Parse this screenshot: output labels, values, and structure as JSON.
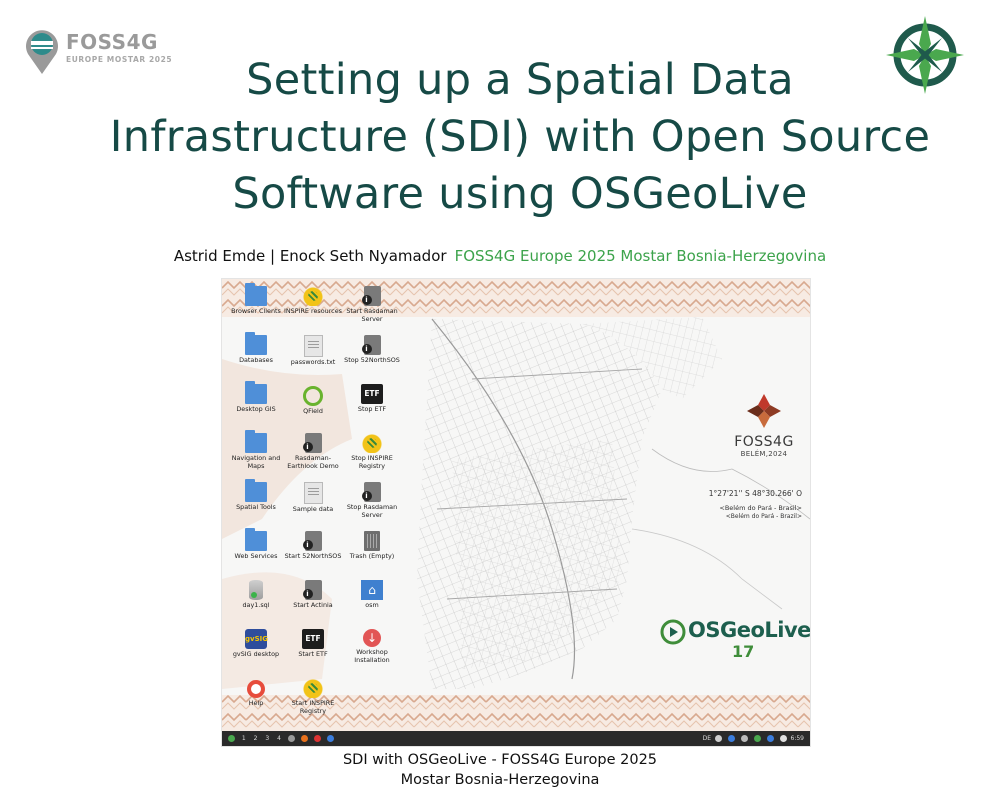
{
  "slide": {
    "logo": {
      "name": "FOSS4G",
      "subtitle": "EUROPE MOSTAR 2025"
    },
    "title_lines": [
      "Setting up a Spatial Data",
      "Infrastructure (SDI) with Open Source",
      "Software using OSGeoLive"
    ],
    "authors": "Astrid Emde | Enock Seth Nyamador",
    "conference": "FOSS4G Europe 2025 Mostar Bosnia-Herzegovina",
    "caption_lines": [
      "SDI with OSGeoLive - FOSS4G Europe 2025",
      "Mostar Bosnia-Herzegovina"
    ]
  },
  "desktop": {
    "icons": [
      {
        "label": "Browser Clients",
        "kind": "folder-icon"
      },
      {
        "label": "INSPIRE resources",
        "kind": "inspire-icon"
      },
      {
        "label": "Start Rasdaman Server",
        "kind": "launcher-icon"
      },
      {
        "label": "Databases",
        "kind": "folder-icon"
      },
      {
        "label": "passwords.txt",
        "kind": "text-file-icon"
      },
      {
        "label": "Stop 52NorthSOS",
        "kind": "launcher-icon"
      },
      {
        "label": "Desktop GIS",
        "kind": "folder-icon"
      },
      {
        "label": "QField",
        "kind": "qfield-icon"
      },
      {
        "label": "Stop ETF",
        "kind": "etf-icon"
      },
      {
        "label": "Navigation and Maps",
        "kind": "folder-icon"
      },
      {
        "label": "Rasdaman-Earthlook Demo",
        "kind": "launcher-icon"
      },
      {
        "label": "Stop INSPIRE Registry",
        "kind": "inspire-icon"
      },
      {
        "label": "Spatial Tools",
        "kind": "folder-icon"
      },
      {
        "label": "Sample data",
        "kind": "text-file-icon"
      },
      {
        "label": "Stop Rasdaman Server",
        "kind": "launcher-icon"
      },
      {
        "label": "Web Services",
        "kind": "folder-icon"
      },
      {
        "label": "Start 52NorthSOS",
        "kind": "launcher-icon"
      },
      {
        "label": "Trash (Empty)",
        "kind": "trash-icon"
      },
      {
        "label": "day1.sql",
        "kind": "database-file-icon"
      },
      {
        "label": "Start Actinia",
        "kind": "launcher-icon"
      },
      {
        "label": "osm",
        "kind": "home-folder-icon"
      },
      {
        "label": "gvSIG desktop",
        "kind": "gvsig-icon"
      },
      {
        "label": "Start ETF",
        "kind": "etf-icon"
      },
      {
        "label": "Workshop Installation",
        "kind": "workshop-icon"
      },
      {
        "label": "Help",
        "kind": "help-icon"
      },
      {
        "label": "Start INSPIRE Registry",
        "kind": "inspire-icon"
      }
    ],
    "wallpaper": {
      "foss4g_name": "FOSS4G",
      "foss4g_place": "BELÉM,2024",
      "coordinates": "1°27'21'' S 48°30.266' O",
      "place_line1": "<Belém do Pará - Brasil>",
      "place_line2": "<Belém do Pará - Brazil>",
      "osgeo_name": "OSGeoLive",
      "osgeo_version": "17"
    },
    "taskbar": {
      "workspaces": [
        "1",
        "2",
        "3",
        "4"
      ],
      "keyboard_layout": "DE",
      "clock": "6:59"
    }
  }
}
